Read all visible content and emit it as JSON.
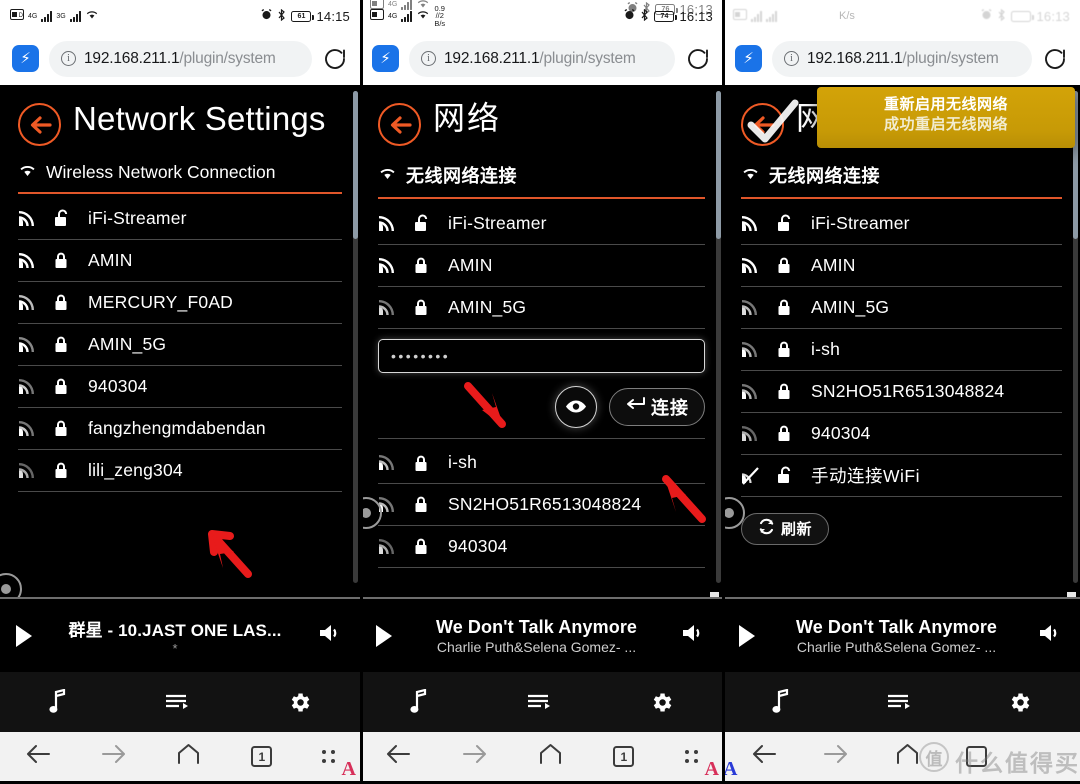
{
  "meta": {
    "brand_orange": "#ef5a25",
    "toast_gold": "#c79a06",
    "accent_blue": "#1a73e8"
  },
  "browser": {
    "url_host": "192.168.211.1",
    "url_path": "/plugin/system",
    "lightning_glyph": "⚡",
    "info_glyph": "i",
    "reload_icon": "reload-icon",
    "lightning_icon": "browser-logo-icon"
  },
  "panels": [
    {
      "id": "panel-english",
      "statusbar": {
        "time": "14:15",
        "battery": "61",
        "signal_sup_1": "4G",
        "signal_sup_2": "3G",
        "icons": [
          "sim-icon",
          "signal-bars-icon",
          "signal-bars-icon",
          "wifi-icon",
          "alarm-icon",
          "bluetooth-icon",
          "battery-icon"
        ]
      },
      "app": {
        "title": "Network Settings",
        "back_icon": "back-arrow-icon",
        "section": "Wireless Network Connection",
        "section_icon": "wifi-icon",
        "networks": [
          {
            "ssid": "iFi-Streamer",
            "lock": "unlocked",
            "signal": "strong"
          },
          {
            "ssid": "AMIN",
            "lock": "locked",
            "signal": "strong"
          },
          {
            "ssid": "MERCURY_F0AD",
            "lock": "locked",
            "signal": "strong"
          },
          {
            "ssid": "AMIN_5G",
            "lock": "locked",
            "signal": "medium"
          },
          {
            "ssid": "940304",
            "lock": "locked",
            "signal": "medium"
          },
          {
            "ssid": "fangzhengmdabendan",
            "lock": "locked",
            "signal": "medium"
          },
          {
            "ssid": "lili_zeng304",
            "lock": "locked",
            "signal": "weak"
          }
        ],
        "has_arrow_annotation": true,
        "arrow_target": "AMIN_5G"
      },
      "player": {
        "track": "群星 - 10.JAST ONE LAS...",
        "artist": "",
        "play_icon": "play-icon",
        "volume_icon": "volume-icon",
        "progress_mark": "*"
      },
      "tabbar": [
        "music-note-icon",
        "playlist-icon",
        "gear-icon"
      ],
      "navbar": [
        "back-arrow-icon",
        "forward-arrow-icon",
        "home-icon",
        "tab-count-icon",
        "menu-dots-icon"
      ],
      "tab_count": "1"
    },
    {
      "id": "panel-chinese-password",
      "statusbar": {
        "time": "16:13",
        "time_ghost": "16:13",
        "battery": "74",
        "battery_ghost": "76",
        "netspeed_top": "0.9",
        "netspeed_mid": "//2",
        "netspeed_unit": "B/s"
      },
      "app": {
        "title": "网络",
        "back_icon": "back-arrow-icon",
        "section": "无线网络连接",
        "section_icon": "wifi-icon",
        "networks_top": [
          {
            "ssid": "iFi-Streamer",
            "lock": "unlocked",
            "signal": "strong"
          },
          {
            "ssid": "AMIN",
            "lock": "locked",
            "signal": "strong"
          },
          {
            "ssid": "AMIN_5G",
            "lock": "locked",
            "signal": "medium"
          }
        ],
        "password_value": "••••••••",
        "password_placeholder": "",
        "eye_icon": "eye-icon",
        "connect_label": "连接",
        "connect_icon": "enter-key-icon",
        "networks_bottom": [
          {
            "ssid": "i-sh",
            "lock": "locked",
            "signal": "medium"
          },
          {
            "ssid": "SN2HO51R6513048824",
            "lock": "locked",
            "signal": "medium"
          },
          {
            "ssid": "940304",
            "lock": "locked",
            "signal": "weak"
          }
        ],
        "has_arrow_annotation": true
      },
      "player": {
        "track": "We Don't Talk Anymore",
        "artist": "Charlie Puth&Selena Gomez- ...",
        "play_icon": "play-icon",
        "volume_icon": "volume-icon"
      },
      "tabbar": [
        "music-note-icon",
        "playlist-icon",
        "gear-icon"
      ],
      "navbar": [
        "back-arrow-icon",
        "forward-arrow-icon",
        "home-icon",
        "tab-count-icon",
        "menu-dots-icon"
      ],
      "tab_count": "1"
    },
    {
      "id": "panel-chinese-toast",
      "statusbar": {
        "time": "16:13",
        "netspeed_unit": "K/s",
        "faded": true
      },
      "app": {
        "title": "网络",
        "back_icon": "back-arrow-icon",
        "section": "无线网络连接",
        "section_icon": "wifi-icon",
        "toast": {
          "line1": "重新启用无线网络",
          "line2": "成功重启无线网络",
          "check_icon": "check-mark-icon"
        },
        "networks": [
          {
            "ssid": "iFi-Streamer",
            "lock": "unlocked",
            "signal": "strong"
          },
          {
            "ssid": "AMIN",
            "lock": "locked",
            "signal": "strong"
          },
          {
            "ssid": "AMIN_5G",
            "lock": "locked",
            "signal": "medium"
          },
          {
            "ssid": "i-sh",
            "lock": "locked",
            "signal": "medium"
          },
          {
            "ssid": "SN2HO51R6513048824",
            "lock": "locked",
            "signal": "medium"
          },
          {
            "ssid": "940304",
            "lock": "locked",
            "signal": "weak"
          },
          {
            "ssid": "手动连接WiFi",
            "lock": "unlocked",
            "signal": "hidden"
          }
        ],
        "refresh_label": "刷新",
        "refresh_icon": "refresh-icon"
      },
      "player": {
        "track": "We Don't Talk Anymore",
        "artist": "Charlie Puth&Selena Gomez- ...",
        "play_icon": "play-icon",
        "volume_icon": "volume-icon"
      },
      "tabbar": [
        "music-note-icon",
        "playlist-icon",
        "gear-icon"
      ],
      "navbar": [
        "back-arrow-icon",
        "forward-arrow-icon",
        "home-icon",
        "tab-count-icon"
      ],
      "watermark": {
        "logo": "值",
        "text": "什么值得买"
      }
    }
  ]
}
